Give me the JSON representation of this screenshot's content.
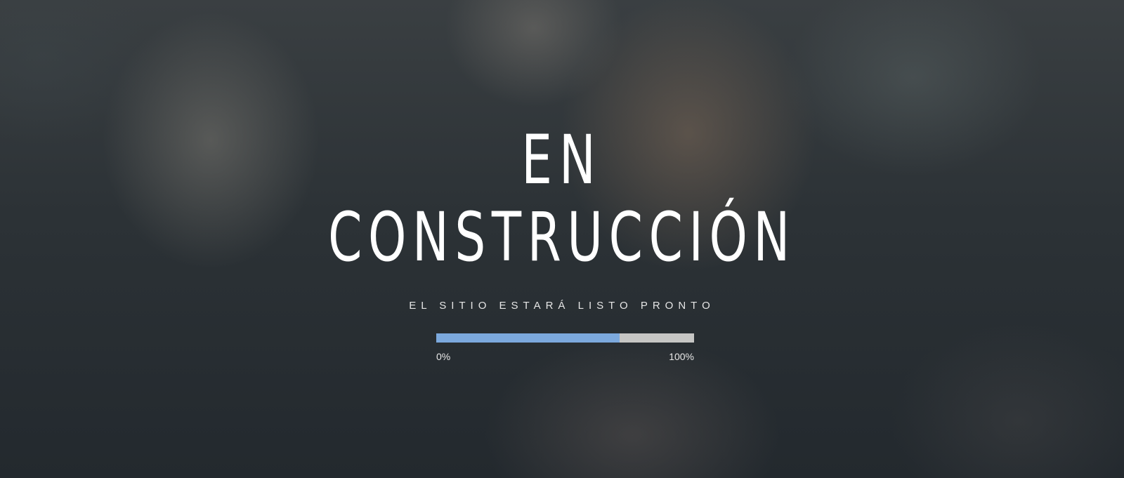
{
  "hero": {
    "title_line1": "EN",
    "title_line2": "CONSTRUCCIÓN",
    "subtitle": "EL SITIO ESTARÁ LISTO PRONTO"
  },
  "progress": {
    "value_percent": 71,
    "min_label": "0%",
    "max_label": "100%",
    "fill_color": "#7ca9dd",
    "track_color": "#c6c6c4"
  },
  "colors": {
    "text": "#ffffff"
  }
}
